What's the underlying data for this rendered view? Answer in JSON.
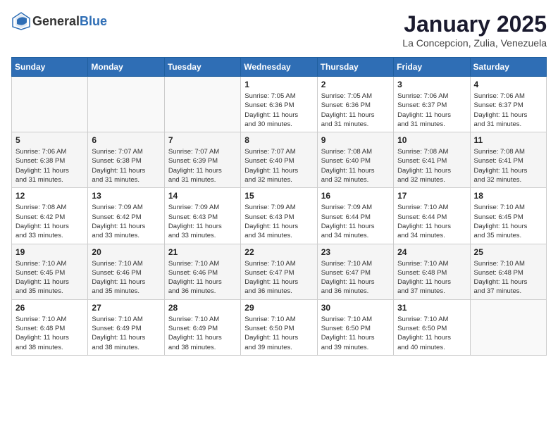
{
  "header": {
    "logo_general": "General",
    "logo_blue": "Blue",
    "month_title": "January 2025",
    "location": "La Concepcion, Zulia, Venezuela"
  },
  "days_of_week": [
    "Sunday",
    "Monday",
    "Tuesday",
    "Wednesday",
    "Thursday",
    "Friday",
    "Saturday"
  ],
  "weeks": [
    [
      {
        "day": "",
        "info": ""
      },
      {
        "day": "",
        "info": ""
      },
      {
        "day": "",
        "info": ""
      },
      {
        "day": "1",
        "info": "Sunrise: 7:05 AM\nSunset: 6:36 PM\nDaylight: 11 hours\nand 30 minutes."
      },
      {
        "day": "2",
        "info": "Sunrise: 7:05 AM\nSunset: 6:36 PM\nDaylight: 11 hours\nand 31 minutes."
      },
      {
        "day": "3",
        "info": "Sunrise: 7:06 AM\nSunset: 6:37 PM\nDaylight: 11 hours\nand 31 minutes."
      },
      {
        "day": "4",
        "info": "Sunrise: 7:06 AM\nSunset: 6:37 PM\nDaylight: 11 hours\nand 31 minutes."
      }
    ],
    [
      {
        "day": "5",
        "info": "Sunrise: 7:06 AM\nSunset: 6:38 PM\nDaylight: 11 hours\nand 31 minutes."
      },
      {
        "day": "6",
        "info": "Sunrise: 7:07 AM\nSunset: 6:38 PM\nDaylight: 11 hours\nand 31 minutes."
      },
      {
        "day": "7",
        "info": "Sunrise: 7:07 AM\nSunset: 6:39 PM\nDaylight: 11 hours\nand 31 minutes."
      },
      {
        "day": "8",
        "info": "Sunrise: 7:07 AM\nSunset: 6:40 PM\nDaylight: 11 hours\nand 32 minutes."
      },
      {
        "day": "9",
        "info": "Sunrise: 7:08 AM\nSunset: 6:40 PM\nDaylight: 11 hours\nand 32 minutes."
      },
      {
        "day": "10",
        "info": "Sunrise: 7:08 AM\nSunset: 6:41 PM\nDaylight: 11 hours\nand 32 minutes."
      },
      {
        "day": "11",
        "info": "Sunrise: 7:08 AM\nSunset: 6:41 PM\nDaylight: 11 hours\nand 32 minutes."
      }
    ],
    [
      {
        "day": "12",
        "info": "Sunrise: 7:08 AM\nSunset: 6:42 PM\nDaylight: 11 hours\nand 33 minutes."
      },
      {
        "day": "13",
        "info": "Sunrise: 7:09 AM\nSunset: 6:42 PM\nDaylight: 11 hours\nand 33 minutes."
      },
      {
        "day": "14",
        "info": "Sunrise: 7:09 AM\nSunset: 6:43 PM\nDaylight: 11 hours\nand 33 minutes."
      },
      {
        "day": "15",
        "info": "Sunrise: 7:09 AM\nSunset: 6:43 PM\nDaylight: 11 hours\nand 34 minutes."
      },
      {
        "day": "16",
        "info": "Sunrise: 7:09 AM\nSunset: 6:44 PM\nDaylight: 11 hours\nand 34 minutes."
      },
      {
        "day": "17",
        "info": "Sunrise: 7:10 AM\nSunset: 6:44 PM\nDaylight: 11 hours\nand 34 minutes."
      },
      {
        "day": "18",
        "info": "Sunrise: 7:10 AM\nSunset: 6:45 PM\nDaylight: 11 hours\nand 35 minutes."
      }
    ],
    [
      {
        "day": "19",
        "info": "Sunrise: 7:10 AM\nSunset: 6:45 PM\nDaylight: 11 hours\nand 35 minutes."
      },
      {
        "day": "20",
        "info": "Sunrise: 7:10 AM\nSunset: 6:46 PM\nDaylight: 11 hours\nand 35 minutes."
      },
      {
        "day": "21",
        "info": "Sunrise: 7:10 AM\nSunset: 6:46 PM\nDaylight: 11 hours\nand 36 minutes."
      },
      {
        "day": "22",
        "info": "Sunrise: 7:10 AM\nSunset: 6:47 PM\nDaylight: 11 hours\nand 36 minutes."
      },
      {
        "day": "23",
        "info": "Sunrise: 7:10 AM\nSunset: 6:47 PM\nDaylight: 11 hours\nand 36 minutes."
      },
      {
        "day": "24",
        "info": "Sunrise: 7:10 AM\nSunset: 6:48 PM\nDaylight: 11 hours\nand 37 minutes."
      },
      {
        "day": "25",
        "info": "Sunrise: 7:10 AM\nSunset: 6:48 PM\nDaylight: 11 hours\nand 37 minutes."
      }
    ],
    [
      {
        "day": "26",
        "info": "Sunrise: 7:10 AM\nSunset: 6:48 PM\nDaylight: 11 hours\nand 38 minutes."
      },
      {
        "day": "27",
        "info": "Sunrise: 7:10 AM\nSunset: 6:49 PM\nDaylight: 11 hours\nand 38 minutes."
      },
      {
        "day": "28",
        "info": "Sunrise: 7:10 AM\nSunset: 6:49 PM\nDaylight: 11 hours\nand 38 minutes."
      },
      {
        "day": "29",
        "info": "Sunrise: 7:10 AM\nSunset: 6:50 PM\nDaylight: 11 hours\nand 39 minutes."
      },
      {
        "day": "30",
        "info": "Sunrise: 7:10 AM\nSunset: 6:50 PM\nDaylight: 11 hours\nand 39 minutes."
      },
      {
        "day": "31",
        "info": "Sunrise: 7:10 AM\nSunset: 6:50 PM\nDaylight: 11 hours\nand 40 minutes."
      },
      {
        "day": "",
        "info": ""
      }
    ]
  ]
}
